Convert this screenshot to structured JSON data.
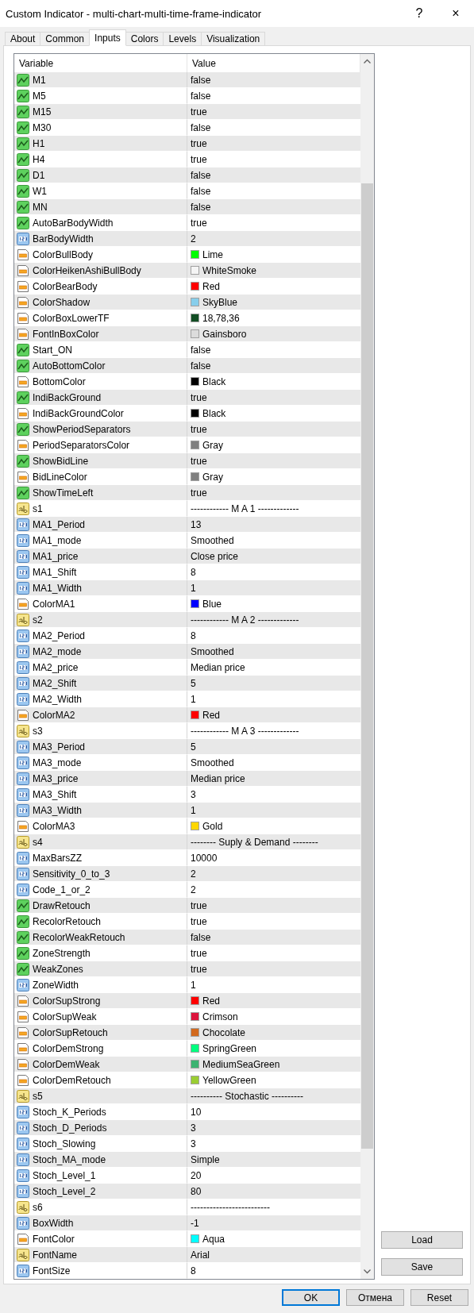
{
  "window": {
    "title": "Custom Indicator - multi-chart-multi-time-frame-indicator",
    "help": "?",
    "close": "×"
  },
  "tabs": [
    {
      "label": "About",
      "selected": false
    },
    {
      "label": "Common",
      "selected": false
    },
    {
      "label": "Inputs",
      "selected": true
    },
    {
      "label": "Colors",
      "selected": false
    },
    {
      "label": "Levels",
      "selected": false
    },
    {
      "label": "Visualization",
      "selected": false
    }
  ],
  "table": {
    "columns": [
      "Variable",
      "Value"
    ],
    "rows": [
      {
        "name": "M1",
        "value": "false",
        "kind": "bool"
      },
      {
        "name": "M5",
        "value": "false",
        "kind": "bool"
      },
      {
        "name": "M15",
        "value": "true",
        "kind": "bool"
      },
      {
        "name": "M30",
        "value": "false",
        "kind": "bool"
      },
      {
        "name": "H1",
        "value": "true",
        "kind": "bool"
      },
      {
        "name": "H4",
        "value": "true",
        "kind": "bool"
      },
      {
        "name": "D1",
        "value": "false",
        "kind": "bool"
      },
      {
        "name": "W1",
        "value": "false",
        "kind": "bool"
      },
      {
        "name": "MN",
        "value": "false",
        "kind": "bool"
      },
      {
        "name": "AutoBarBodyWidth",
        "value": "true",
        "kind": "bool"
      },
      {
        "name": "BarBodyWidth",
        "value": "2",
        "kind": "number"
      },
      {
        "name": "ColorBullBody",
        "value": "Lime",
        "kind": "color",
        "color": "#00ff00"
      },
      {
        "name": "ColorHeikenAshiBullBody",
        "value": "WhiteSmoke",
        "kind": "color",
        "color": "#f5f5f5"
      },
      {
        "name": "ColorBearBody",
        "value": "Red",
        "kind": "color",
        "color": "#ff0000"
      },
      {
        "name": "ColorShadow",
        "value": "SkyBlue",
        "kind": "color",
        "color": "#87ceeb"
      },
      {
        "name": "ColorBoxLowerTF",
        "value": "18,78,36",
        "kind": "color",
        "color": "#124e24"
      },
      {
        "name": "FontInBoxColor",
        "value": "Gainsboro",
        "kind": "color",
        "color": "#dcdcdc"
      },
      {
        "name": "Start_ON",
        "value": "false",
        "kind": "bool"
      },
      {
        "name": "AutoBottomColor",
        "value": "false",
        "kind": "bool"
      },
      {
        "name": "BottomColor",
        "value": "Black",
        "kind": "color",
        "color": "#000000"
      },
      {
        "name": "IndiBackGround",
        "value": "true",
        "kind": "bool"
      },
      {
        "name": "IndiBackGroundColor",
        "value": "Black",
        "kind": "color",
        "color": "#000000"
      },
      {
        "name": "ShowPeriodSeparators",
        "value": "true",
        "kind": "bool"
      },
      {
        "name": "PeriodSeparatorsColor",
        "value": "Gray",
        "kind": "color",
        "color": "#808080"
      },
      {
        "name": "ShowBidLine",
        "value": "true",
        "kind": "bool"
      },
      {
        "name": "BidLineColor",
        "value": "Gray",
        "kind": "color",
        "color": "#808080"
      },
      {
        "name": "ShowTimeLeft",
        "value": "true",
        "kind": "bool"
      },
      {
        "name": "s1",
        "value": "------------ M A 1 -------------",
        "kind": "text"
      },
      {
        "name": "MA1_Period",
        "value": "13",
        "kind": "number"
      },
      {
        "name": "MA1_mode",
        "value": "Smoothed",
        "kind": "number"
      },
      {
        "name": "MA1_price",
        "value": "Close price",
        "kind": "number"
      },
      {
        "name": "MA1_Shift",
        "value": "8",
        "kind": "number"
      },
      {
        "name": "MA1_Width",
        "value": "1",
        "kind": "number"
      },
      {
        "name": "ColorMA1",
        "value": "Blue",
        "kind": "color",
        "color": "#0000ff"
      },
      {
        "name": "s2",
        "value": "------------ M A 2 -------------",
        "kind": "text"
      },
      {
        "name": "MA2_Period",
        "value": "8",
        "kind": "number"
      },
      {
        "name": "MA2_mode",
        "value": "Smoothed",
        "kind": "number"
      },
      {
        "name": "MA2_price",
        "value": "Median price",
        "kind": "number"
      },
      {
        "name": "MA2_Shift",
        "value": "5",
        "kind": "number"
      },
      {
        "name": "MA2_Width",
        "value": "1",
        "kind": "number"
      },
      {
        "name": "ColorMA2",
        "value": "Red",
        "kind": "color",
        "color": "#ff0000"
      },
      {
        "name": "s3",
        "value": "------------ M A 3 -------------",
        "kind": "text"
      },
      {
        "name": "MA3_Period",
        "value": "5",
        "kind": "number"
      },
      {
        "name": "MA3_mode",
        "value": "Smoothed",
        "kind": "number"
      },
      {
        "name": "MA3_price",
        "value": "Median price",
        "kind": "number"
      },
      {
        "name": "MA3_Shift",
        "value": "3",
        "kind": "number"
      },
      {
        "name": "MA3_Width",
        "value": "1",
        "kind": "number"
      },
      {
        "name": "ColorMA3",
        "value": "Gold",
        "kind": "color",
        "color": "#ffd700"
      },
      {
        "name": "s4",
        "value": "-------- Suply & Demand --------",
        "kind": "text"
      },
      {
        "name": "MaxBarsZZ",
        "value": "10000",
        "kind": "number"
      },
      {
        "name": "Sensitivity_0_to_3",
        "value": "2",
        "kind": "number"
      },
      {
        "name": "Code_1_or_2",
        "value": "2",
        "kind": "number"
      },
      {
        "name": "DrawRetouch",
        "value": "true",
        "kind": "bool"
      },
      {
        "name": "RecolorRetouch",
        "value": "true",
        "kind": "bool"
      },
      {
        "name": "RecolorWeakRetouch",
        "value": "false",
        "kind": "bool"
      },
      {
        "name": "ZoneStrength",
        "value": "true",
        "kind": "bool"
      },
      {
        "name": "WeakZones",
        "value": "true",
        "kind": "bool"
      },
      {
        "name": "ZoneWidth",
        "value": "1",
        "kind": "number"
      },
      {
        "name": "ColorSupStrong",
        "value": "Red",
        "kind": "color",
        "color": "#ff0000"
      },
      {
        "name": "ColorSupWeak",
        "value": "Crimson",
        "kind": "color",
        "color": "#dc143c"
      },
      {
        "name": "ColorSupRetouch",
        "value": "Chocolate",
        "kind": "color",
        "color": "#d2691e"
      },
      {
        "name": "ColorDemStrong",
        "value": "SpringGreen",
        "kind": "color",
        "color": "#00ff7f"
      },
      {
        "name": "ColorDemWeak",
        "value": "MediumSeaGreen",
        "kind": "color",
        "color": "#3cb371"
      },
      {
        "name": "ColorDemRetouch",
        "value": "YellowGreen",
        "kind": "color",
        "color": "#9acd32"
      },
      {
        "name": "s5",
        "value": "---------- Stochastic ----------",
        "kind": "text"
      },
      {
        "name": "Stoch_K_Periods",
        "value": "10",
        "kind": "number"
      },
      {
        "name": "Stoch_D_Periods",
        "value": "3",
        "kind": "number"
      },
      {
        "name": "Stoch_Slowing",
        "value": "3",
        "kind": "number"
      },
      {
        "name": "Stoch_MA_mode",
        "value": "Simple",
        "kind": "number"
      },
      {
        "name": "Stoch_Level_1",
        "value": "20",
        "kind": "number"
      },
      {
        "name": "Stoch_Level_2",
        "value": "80",
        "kind": "number"
      },
      {
        "name": "s6",
        "value": "-------------------------",
        "kind": "text"
      },
      {
        "name": "BoxWidth",
        "value": "-1",
        "kind": "number"
      },
      {
        "name": "FontColor",
        "value": "Aqua",
        "kind": "color",
        "color": "#00ffff"
      },
      {
        "name": "FontName",
        "value": "Arial",
        "kind": "text"
      },
      {
        "name": "FontSize",
        "value": "8",
        "kind": "number"
      }
    ]
  },
  "side_buttons": [
    "Load",
    "Save"
  ],
  "buttons": [
    {
      "label": "OK",
      "default": true
    },
    {
      "label": "Отмена",
      "default": false
    },
    {
      "label": "Reset",
      "default": false
    }
  ]
}
